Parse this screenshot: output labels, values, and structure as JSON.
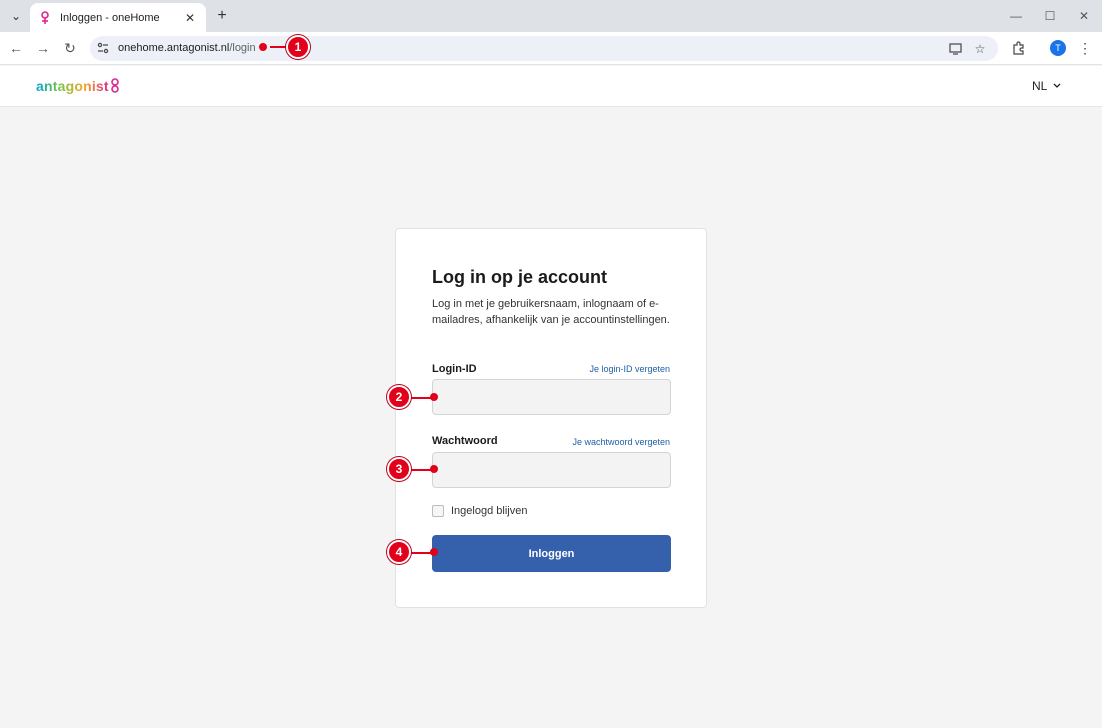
{
  "browser": {
    "tab_title": "Inloggen - oneHome",
    "url_host": "onehome.antagonist.nl",
    "url_path": "/login",
    "profile_initial": "T"
  },
  "site": {
    "logo_text": "antagonist",
    "language": "NL"
  },
  "login": {
    "heading": "Log in op je account",
    "description": "Log in met je gebruikersnaam, inlognaam of e-mailadres, afhankelijk van je accountinstellingen.",
    "login_id_label": "Login-ID",
    "login_id_forgot": "Je login-ID vergeten",
    "password_label": "Wachtwoord",
    "password_forgot": "Je wachtwoord vergeten",
    "remember_label": "Ingelogd blijven",
    "submit_label": "Inloggen"
  },
  "markers": [
    "1",
    "2",
    "3",
    "4"
  ],
  "colors": {
    "accent": "#3460ac",
    "link": "#1d5fa8",
    "marker": "#e3001b"
  }
}
